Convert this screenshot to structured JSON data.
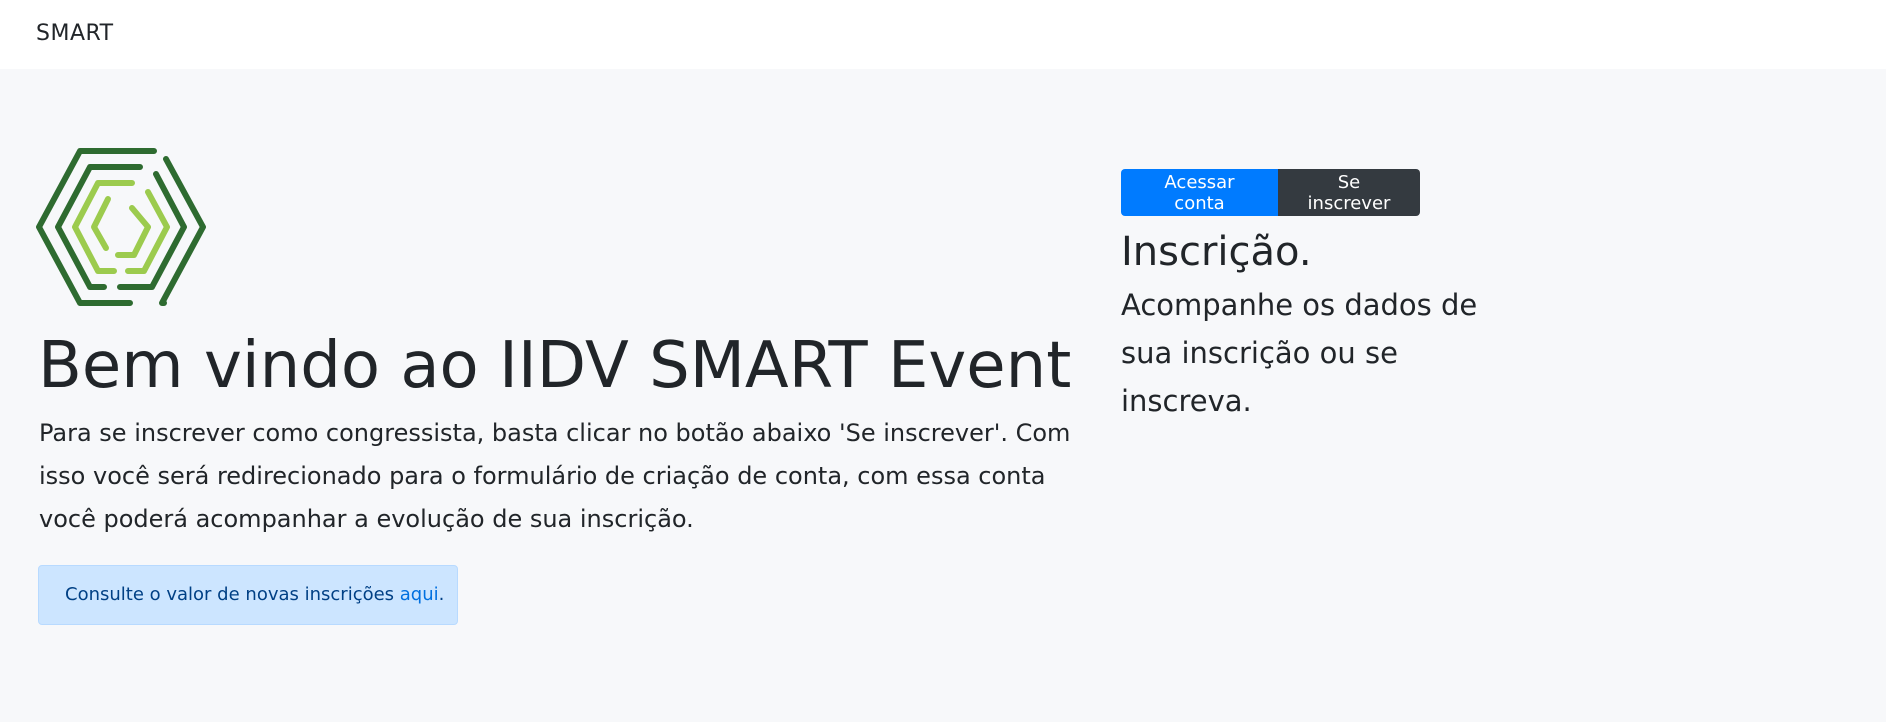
{
  "navbar": {
    "brand": "SMART"
  },
  "hero": {
    "logo_icon": "hexagon-maze-logo-icon",
    "title": "Bem vindo ao IIDV SMART Event",
    "intro": "Para se inscrever como congressista, basta clicar no botão abaixo 'Se inscrever'. Com isso você será redirecionado para o formulário de criação de conta, com essa conta você poderá acompanhar a evolução de sua inscrição.",
    "alert": {
      "text": "Consulte o valor de novas inscrições ",
      "link": "aqui",
      "suffix": "."
    }
  },
  "sidebar": {
    "buttons": {
      "login": "Acessar conta",
      "signup": "Se inscrever"
    },
    "title": "Inscrição.",
    "text": "Acompanhe os dados de sua inscrição ou se inscreva."
  },
  "colors": {
    "primary": "#007bff",
    "dark": "#343a40",
    "alert_bg": "#cce5ff",
    "logo_dark_green": "#2e6b30",
    "logo_light_green": "#9ccb4e"
  }
}
